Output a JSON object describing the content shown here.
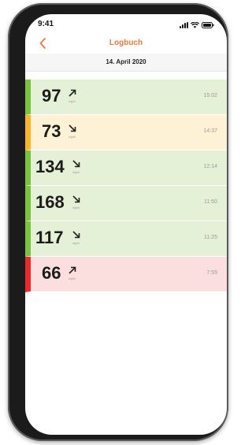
{
  "status_bar": {
    "time": "9:41",
    "icons": [
      "signal-icon",
      "wifi-icon",
      "battery-icon"
    ]
  },
  "nav": {
    "back_icon": "chevron-left-icon",
    "title": "Logbuch",
    "accent_color": "#ec7a3c"
  },
  "date_header": "14. April 2020",
  "colors": {
    "green": "#7cc242",
    "yellow": "#f8b52d",
    "red": "#e62a2e"
  },
  "entries": [
    {
      "value": "97",
      "unit": "mg/dl",
      "trend": "arrow-up-right-icon",
      "time": "15:02",
      "status": "green"
    },
    {
      "value": "73",
      "unit": "mg/dl",
      "trend": "arrow-down-right-icon",
      "time": "14:37",
      "status": "yellow"
    },
    {
      "value": "134",
      "unit": "mg/dl",
      "trend": "arrow-down-right-icon",
      "time": "12:14",
      "status": "green"
    },
    {
      "value": "168",
      "unit": "mg/dl",
      "trend": "arrow-down-right-icon",
      "time": "11:50",
      "status": "green"
    },
    {
      "value": "117",
      "unit": "mg/dl",
      "trend": "arrow-down-right-icon",
      "time": "11:25",
      "status": "green"
    },
    {
      "value": "66",
      "unit": "mg/dl",
      "trend": "arrow-up-right-icon",
      "time": "7:55",
      "status": "red"
    }
  ]
}
